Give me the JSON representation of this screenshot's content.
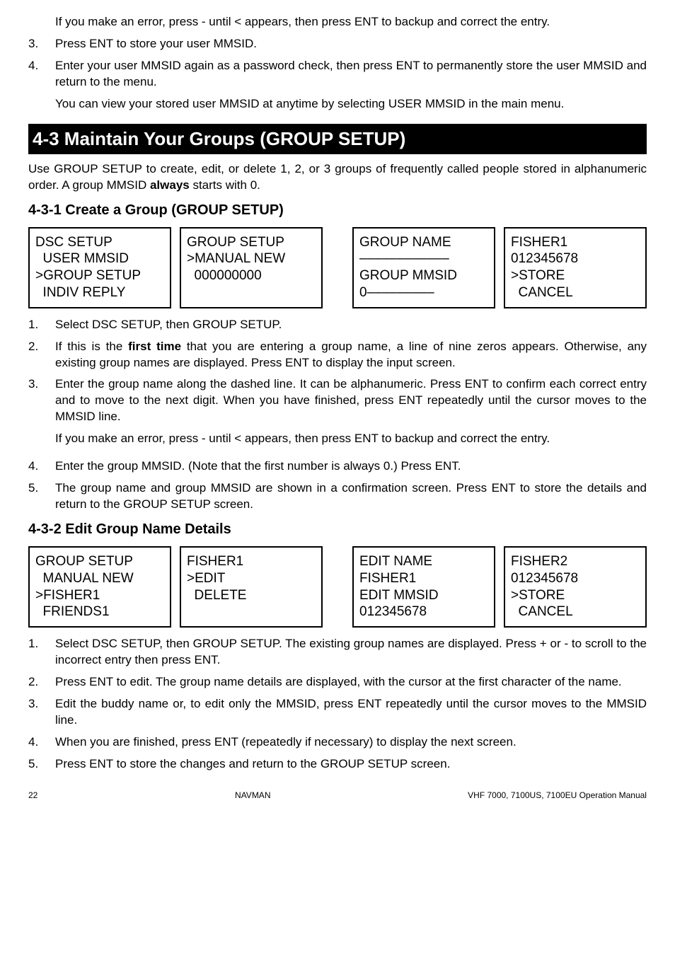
{
  "intro": {
    "p_err": "If you make an error, press - until < appears, then press ENT to backup and correct the entry.",
    "li3": "Press ENT to store your user MMSID.",
    "li4a": "Enter your user MMSID again as a password check, then press ENT to permanently store the user MMSID and return to the menu.",
    "li4b": "You can view your stored user MMSID at anytime by selecting USER MMSID in the main menu."
  },
  "section43": {
    "title": "4-3 Maintain Your Groups (GROUP SETUP)",
    "p1a": "Use GROUP SETUP to create, edit, or delete 1, 2, or 3 groups of frequently called people stored in alphanumeric order. A group MMSID ",
    "p1_bold": "always",
    "p1b": " starts with 0."
  },
  "s431": {
    "title": "4-3-1 Create a Group (GROUP SETUP)",
    "screens": [
      "DSC SETUP\n  USER MMSID\n>GROUP SETUP\n  INDIV REPLY",
      "GROUP SETUP\n>MANUAL NEW\n  000000000\n",
      "GROUP NAME\n––––––––––––\nGROUP MMSID\n0–––––––––",
      "FISHER1\n012345678\n>STORE\n  CANCEL"
    ],
    "li1": "Select DSC SETUP, then GROUP SETUP.",
    "li2a": "If this is the ",
    "li2_bold": "first time",
    "li2b": " that you are entering a group name, a line of nine zeros appears. Otherwise, any existing group names are displayed. Press ENT to display the input screen.",
    "li3": "Enter the group name along the dashed line. It can be alphanumeric. Press ENT to confirm each correct entry and to move to the next digit. When you have finished, press ENT repeatedly until the cursor moves to the MMSID line.",
    "li3_err": "If you make an error, press - until < appears, then press ENT to backup and correct the entry.",
    "li4": "Enter the group MMSID. (Note that the first number is always 0.) Press ENT.",
    "li5": "The group name and group MMSID are shown in a confirmation screen. Press ENT to store the details and return to the GROUP SETUP screen."
  },
  "s432": {
    "title": "4-3-2 Edit Group Name Details",
    "screens": [
      "GROUP SETUP\n  MANUAL NEW\n>FISHER1\n  FRIENDS1",
      "FISHER1\n>EDIT\n  DELETE\n",
      "EDIT NAME\nFISHER1\nEDIT MMSID\n012345678",
      "FISHER2\n012345678\n>STORE\n  CANCEL"
    ],
    "li1": "Select DSC SETUP, then GROUP SETUP. The existing group names are displayed. Press + or - to scroll to the incorrect entry then press ENT.",
    "li2": "Press ENT to edit. The group name details are displayed, with the cursor at the first character of the name.",
    "li3": "Edit the buddy name or, to edit only the MMSID, press ENT repeatedly until the cursor moves to the MMSID line.",
    "li4": "When you are finished, press ENT (repeatedly if necessary) to display the next screen.",
    "li5": "Press ENT to store the changes and return to the GROUP SETUP screen."
  },
  "footer": {
    "page": "22",
    "center": "NAVMAN",
    "right": "VHF 7000, 7100US, 7100EU Operation Manual"
  },
  "nums": {
    "n2": "2.",
    "n3": "3.",
    "n4": "4.",
    "n5": "5.",
    "n1": "1."
  }
}
